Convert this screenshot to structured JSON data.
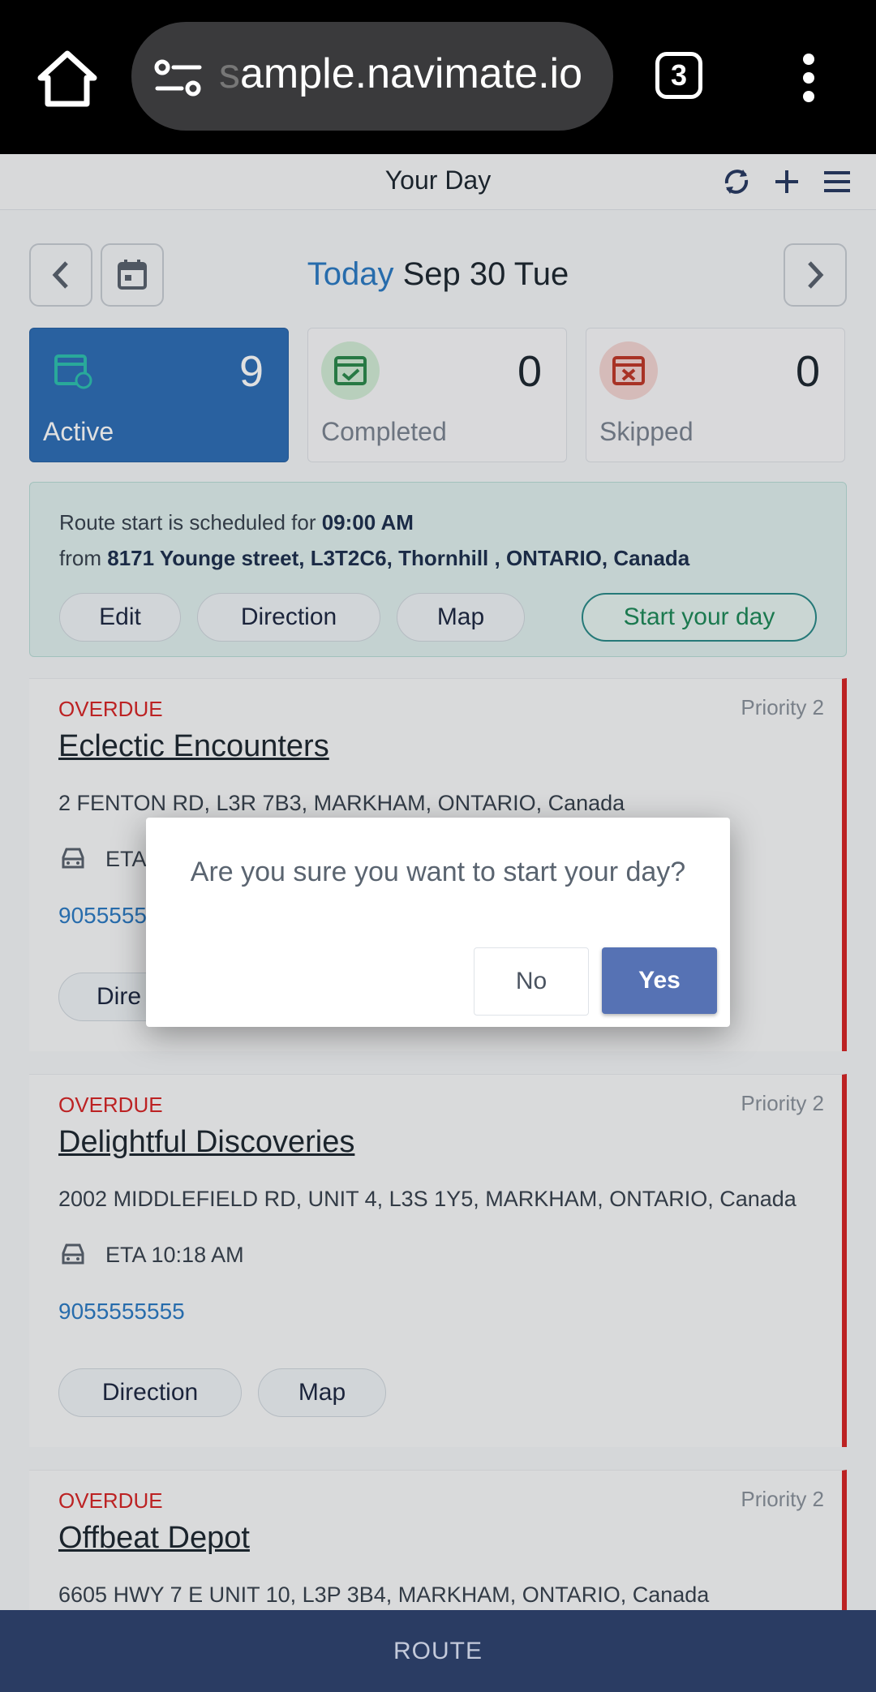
{
  "browser": {
    "url_faded": "s",
    "url": "ample.navimate.io",
    "tab_count": "3"
  },
  "header": {
    "title": "Your Day"
  },
  "date": {
    "today_label": "Today",
    "date": "Sep 30 Tue"
  },
  "stats": [
    {
      "count": "9",
      "label": "Active"
    },
    {
      "count": "0",
      "label": "Completed"
    },
    {
      "count": "0",
      "label": "Skipped"
    }
  ],
  "route_start": {
    "line1_prefix": "Route start is scheduled for ",
    "time": "09:00 AM",
    "line2_prefix": "from ",
    "address": "8171 Younge street, L3T2C6, Thornhill , ONTARIO, Canada",
    "buttons": {
      "edit": "Edit",
      "direction": "Direction",
      "map": "Map",
      "start": "Start your day"
    }
  },
  "stops": [
    {
      "status": "OVERDUE",
      "priority": "Priority  2",
      "name": "Eclectic Encounters",
      "address": "2 FENTON RD, L3R 7B3, MARKHAM, ONTARIO, Canada",
      "eta": "ETA",
      "phone": "9055555",
      "btn1": "Dire"
    },
    {
      "status": "OVERDUE",
      "priority": "Priority  2",
      "name": "Delightful Discoveries",
      "address": "2002 MIDDLEFIELD RD, UNIT 4, L3S 1Y5, MARKHAM, ONTARIO, Canada",
      "eta": "ETA 10:18 AM",
      "phone": "9055555555",
      "btn1": "Direction",
      "btn2": "Map"
    },
    {
      "status": "OVERDUE",
      "priority": "Priority  2",
      "name": "Offbeat Depot",
      "address": "6605 HWY 7 E UNIT 10, L3P 3B4, MARKHAM, ONTARIO, Canada"
    }
  ],
  "dialog": {
    "question": "Are you sure you want to start your day?",
    "no": "No",
    "yes": "Yes"
  },
  "footer": {
    "route": "ROUTE"
  },
  "colors": {
    "accent_blue": "#2f6fb7",
    "overdue_red": "#d62728",
    "start_green": "#1f8a5a",
    "dialog_yes": "#5672b4",
    "bottom_bar": "#2a3c63"
  }
}
